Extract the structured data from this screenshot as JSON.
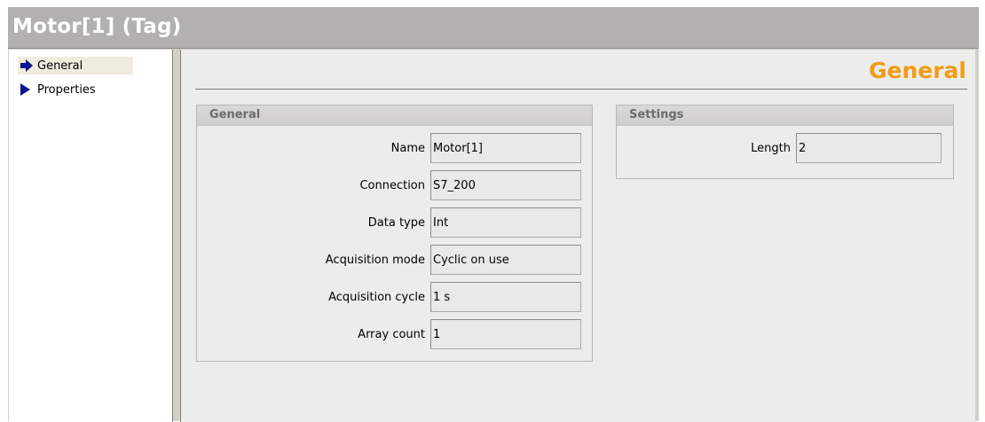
{
  "window": {
    "title": "Motor[1] (Tag)"
  },
  "nav": {
    "items": [
      {
        "label": "General",
        "selected": true
      },
      {
        "label": "Properties",
        "selected": false
      }
    ]
  },
  "page": {
    "heading": "General"
  },
  "general_group": {
    "title": "General",
    "fields": [
      {
        "label": "Name",
        "value": "Motor[1]"
      },
      {
        "label": "Connection",
        "value": "S7_200"
      },
      {
        "label": "Data type",
        "value": "Int"
      },
      {
        "label": "Acquisition mode",
        "value": "Cyclic on use"
      },
      {
        "label": "Acquisition cycle",
        "value": "1 s"
      },
      {
        "label": "Array count",
        "value": "1"
      }
    ]
  },
  "settings_group": {
    "title": "Settings",
    "fields": [
      {
        "label": "Length",
        "value": "2"
      }
    ]
  },
  "colors": {
    "title_bar": "#b2b0b0",
    "heading_accent": "#f29b14",
    "nav_arrow": "#0a148f",
    "selected_nav": "#efebde"
  },
  "icons": {
    "general": "arrow-right-filled-icon",
    "properties": "triangle-right-icon"
  }
}
